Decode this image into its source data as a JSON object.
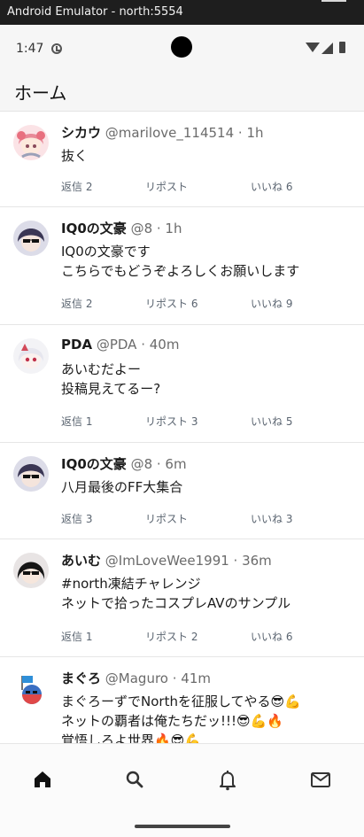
{
  "emulator": {
    "title": "Android Emulator - north:5554"
  },
  "status_bar": {
    "time": "1:47"
  },
  "header": {
    "title": "ホーム"
  },
  "posts": [
    {
      "name": "シカウ",
      "sub": "@marilove_114514 · 1h",
      "lines": [
        "抜く"
      ],
      "reply": "返信 2",
      "repost": "リポスト",
      "like": "いいね 6"
    },
    {
      "name": "IQ0の文豪",
      "sub": "@8 · 1h",
      "lines": [
        "IQ0の文豪です",
        "こちらでもどうぞよろしくお願いします"
      ],
      "reply": "返信 2",
      "repost": "リポスト 6",
      "like": "いいね 9"
    },
    {
      "name": "PDA",
      "sub": "@PDA · 40m",
      "lines": [
        "あいむだよー",
        "投稿見えてるー?"
      ],
      "reply": "返信 1",
      "repost": "リポスト 3",
      "like": "いいね 5"
    },
    {
      "name": "IQ0の文豪",
      "sub": "@8 · 6m",
      "lines": [
        "八月最後のFF大集合"
      ],
      "reply": "返信 3",
      "repost": "リポスト",
      "like": "いいね 3"
    },
    {
      "name": "あいむ",
      "sub": "@ImLoveWee1991 · 36m",
      "lines": [
        "#north凍結チャレンジ",
        "ネットで拾ったコスプレAVのサンプル"
      ],
      "reply": "返信 1",
      "repost": "リポスト 2",
      "like": "いいね 6"
    },
    {
      "name": "まぐろ",
      "sub": "@Maguro · 41m",
      "lines": [
        "まぐろーずでNorthを征服してやる😎💪",
        "ネットの覇者は俺たちだッ!!!😎💪🔥",
        "覚悟しろよ世界🔥😎💪"
      ]
    }
  ],
  "nav": [
    {
      "icon": "home-icon"
    },
    {
      "icon": "search-icon"
    },
    {
      "icon": "bell-icon"
    },
    {
      "icon": "mail-icon"
    }
  ]
}
